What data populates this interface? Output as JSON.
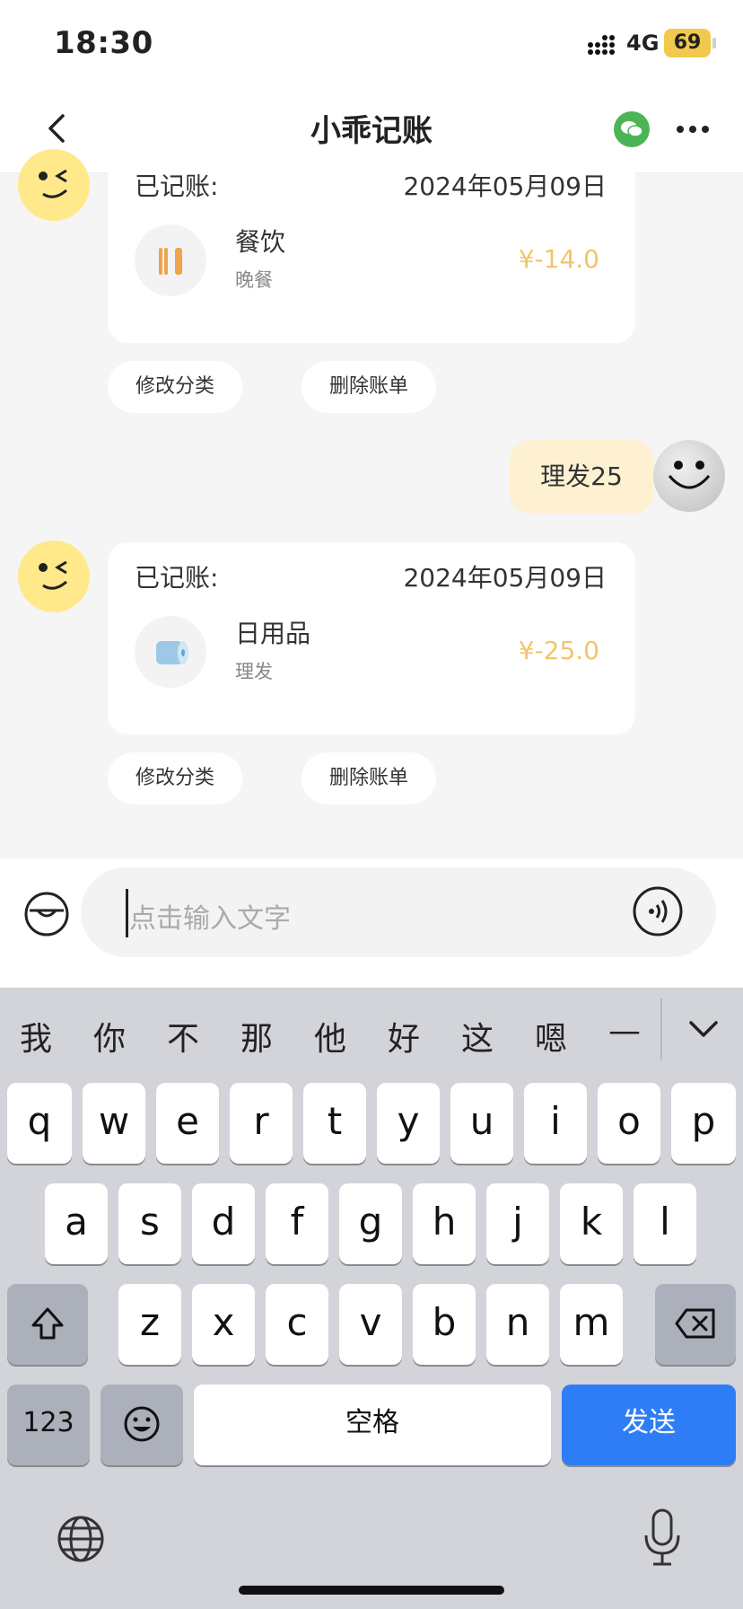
{
  "status": {
    "time": "18:30",
    "network": "4G",
    "battery": "69"
  },
  "nav": {
    "title": "小乖记账"
  },
  "messages": [
    {
      "label": "已记账:",
      "date": "2024年05月09日",
      "category": "餐饮",
      "note": "晚餐",
      "category_icon": "utensils-icon",
      "amount": "¥-14.0",
      "actions": [
        "修改分类",
        "删除账单"
      ]
    },
    {
      "user_text": "理发25"
    },
    {
      "label": "已记账:",
      "date": "2024年05月09日",
      "category": "日用品",
      "note": "理发",
      "category_icon": "tissue-roll-icon",
      "amount": "¥-25.0",
      "actions": [
        "修改分类",
        "删除账单"
      ]
    }
  ],
  "input": {
    "placeholder": "点击输入文字"
  },
  "keyboard": {
    "candidates": [
      "我",
      "你",
      "不",
      "那",
      "他",
      "好",
      "这",
      "嗯",
      "—"
    ],
    "row1": [
      "q",
      "w",
      "e",
      "r",
      "t",
      "y",
      "u",
      "i",
      "o",
      "p"
    ],
    "row2": [
      "a",
      "s",
      "d",
      "f",
      "g",
      "h",
      "j",
      "k",
      "l"
    ],
    "row3": [
      "z",
      "x",
      "c",
      "v",
      "b",
      "n",
      "m"
    ],
    "numbers_label": "123",
    "space_label": "空格",
    "send_label": "发送"
  },
  "colors": {
    "amount": "#f2c46d",
    "send": "#2f7df6",
    "wechat": "#4bb555"
  }
}
